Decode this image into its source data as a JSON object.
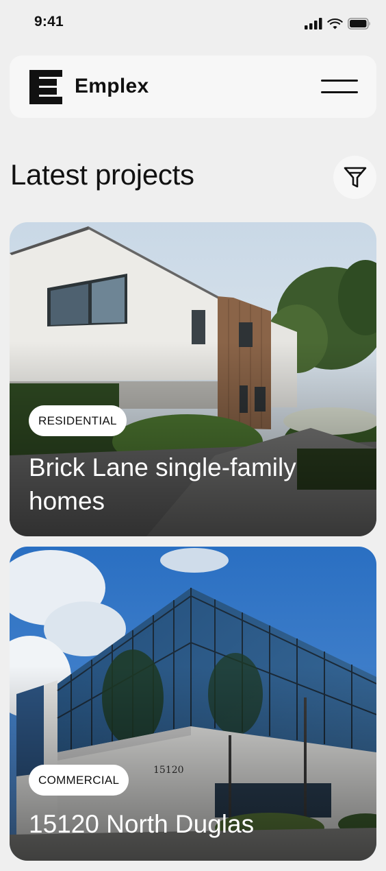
{
  "status_bar": {
    "time": "9:41"
  },
  "header": {
    "brand": "Emplex"
  },
  "page": {
    "title": "Latest projects"
  },
  "projects": [
    {
      "category": "RESIDENTIAL",
      "title": "Brick Lane single-family homes"
    },
    {
      "category": "COMMERCIAL",
      "title": "15120 North Duglas",
      "address_number": "15120"
    }
  ],
  "icons": {
    "status": [
      "cellular-signal-icon",
      "wifi-icon",
      "battery-icon"
    ],
    "header": [
      "emplex-logo",
      "hamburger-menu-icon"
    ],
    "filter": "filter-icon"
  },
  "colors": {
    "background": "#efefef",
    "surface": "#f7f7f7",
    "text": "#111111",
    "tag_bg": "#ffffff"
  }
}
